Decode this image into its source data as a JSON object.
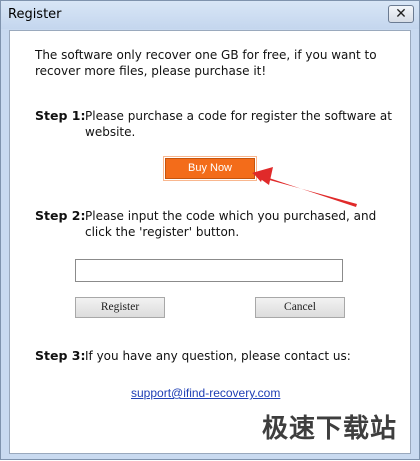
{
  "window": {
    "title": "Register",
    "close_symbol": "✕"
  },
  "intro": "The software only recover one GB for free, if you want to recover more files, please purchase it!",
  "step1": {
    "label": "Step 1:",
    "text": "Please purchase a code for register the software at website.",
    "buy_button": "Buy Now"
  },
  "step2": {
    "label": "Step 2:",
    "text": "Please input the code which you purchased, and click the 'register' button.",
    "code_value": "",
    "register_button": "Register",
    "cancel_button": "Cancel"
  },
  "step3": {
    "label": "Step 3:",
    "text": "If you have any question, please contact us:",
    "support_email": "support@ifind-recovery.com"
  },
  "watermark": "极速下载站",
  "colors": {
    "buy_button": "#f36c1a",
    "arrow": "#e02a2a",
    "link": "#1f3fb5"
  }
}
